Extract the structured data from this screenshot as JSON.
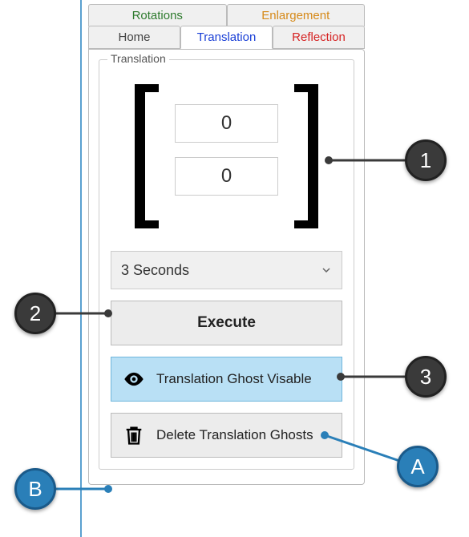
{
  "tabs_top": {
    "rotations": "Rotations",
    "enlargement": "Enlargement"
  },
  "tabs_bottom": {
    "home": "Home",
    "translation": "Translation",
    "reflection": "Reflection"
  },
  "fieldset_label": "Translation",
  "vector": {
    "x": "0",
    "y": "0"
  },
  "duration": {
    "selected": "3 Seconds"
  },
  "buttons": {
    "execute": "Execute",
    "ghost_visible": "Translation Ghost Visable",
    "delete_ghosts": "Delete Translation Ghosts"
  },
  "callouts": {
    "c1": "1",
    "c2": "2",
    "c3": "3",
    "cA": "A",
    "cB": "B"
  }
}
